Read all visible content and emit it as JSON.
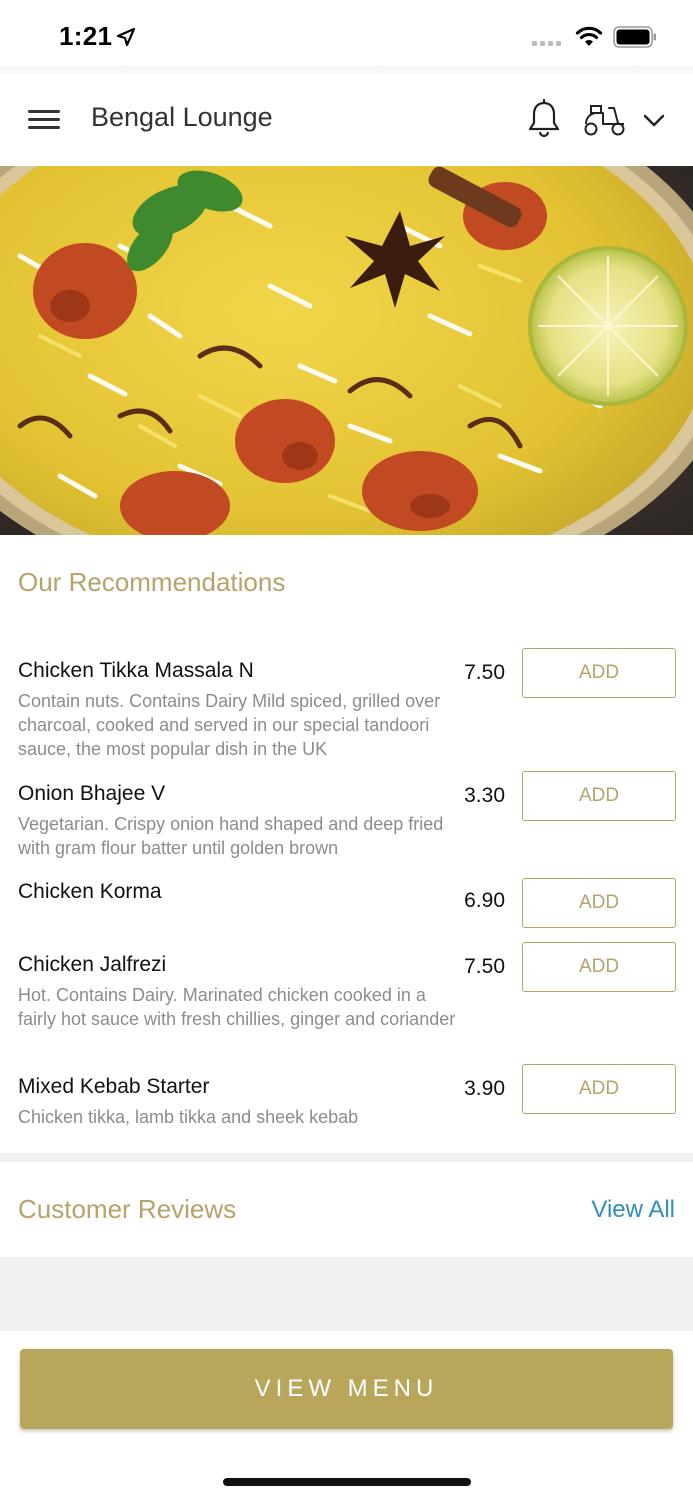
{
  "status_bar": {
    "time": "1:21"
  },
  "header": {
    "title": "Bengal Lounge"
  },
  "recommendations": {
    "title": "Our Recommendations",
    "add_label": "ADD",
    "items": [
      {
        "name": "Chicken Tikka Massala N",
        "price": "7.50",
        "description": "Contain nuts. Contains Dairy Mild spiced, grilled over charcoal, cooked and served in our special tandoori sauce, the most popular dish in the UK"
      },
      {
        "name": "Onion Bhajee V",
        "price": "3.30",
        "description": "Vegetarian. Crispy onion hand shaped and deep fried with gram flour batter until golden brown"
      },
      {
        "name": "Chicken Korma",
        "price": "6.90",
        "description": ""
      },
      {
        "name": "Chicken Jalfrezi",
        "price": "7.50",
        "description": "Hot. Contains Dairy. Marinated chicken cooked in a fairly hot sauce with fresh chillies, ginger and coriander"
      },
      {
        "name": "Mixed Kebab Starter",
        "price": "3.90",
        "description": "Chicken tikka, lamb tikka and sheek kebab"
      }
    ]
  },
  "reviews": {
    "title": "Customer Reviews",
    "view_all": "View All"
  },
  "footer": {
    "view_menu": "VIEW MENU"
  },
  "colors": {
    "accent": "#b8a75a",
    "link": "#2f8fb8",
    "muted": "#8c8c8c"
  },
  "icons": [
    "location-arrow-icon",
    "signal-icon",
    "wifi-icon",
    "battery-icon",
    "hamburger-menu-icon",
    "bell-icon",
    "scooter-delivery-icon",
    "chevron-down-icon"
  ]
}
